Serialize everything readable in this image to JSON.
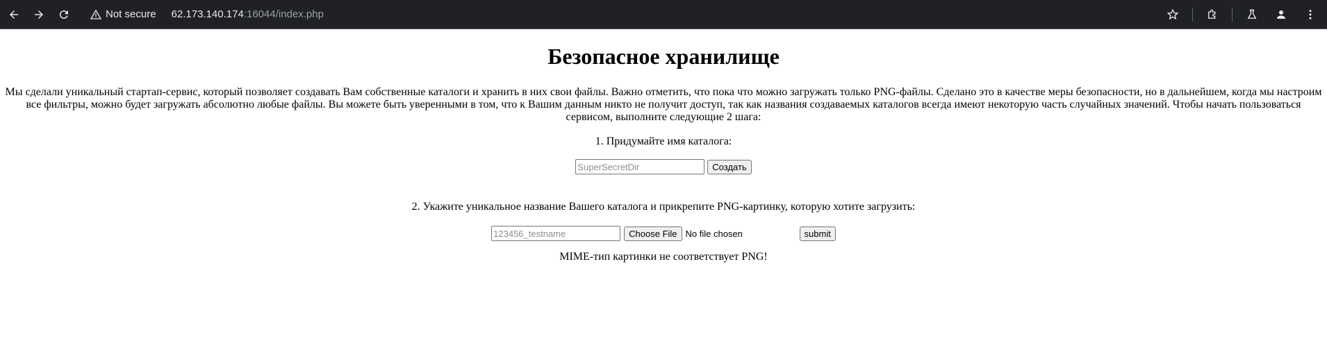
{
  "browser": {
    "security_label": "Not secure",
    "url_host": "62.173.140.174",
    "url_rest": ":16044/index.php"
  },
  "page": {
    "title": "Безопасное хранилище",
    "intro": "Мы сделали уникальный стартап-сервис, который позволяет создавать Вам собственные каталоги и хранить в них свои файлы. Важно отметить, что пока что можно загружать только PNG-файлы. Сделано это в качестве меры безопасности, но в дальнейшем, когда мы настроим все фильтры, можно будет загружать абсолютно любые файлы. Вы можете быть уверенными в том, что к Вашим данным никто не получит доступ, так как названия создаваемых каталогов всегда имеют некоторую часть случайных значений. Чтобы начать пользоваться сервисом, выполните следующие 2 шага:",
    "step1": {
      "label": "1. Придумайте имя каталога:",
      "placeholder": "SuperSecretDir",
      "button": "Создать"
    },
    "step2": {
      "label": "2. Укажите уникальное название Вашего каталога и прикрепите PNG-картинку, которую хотите загрузить:",
      "placeholder": "123456_testname",
      "file_button": "Choose File",
      "file_status": "No file chosen",
      "submit": "submit"
    },
    "message": "MIME-тип картинки не соответствует PNG!"
  }
}
